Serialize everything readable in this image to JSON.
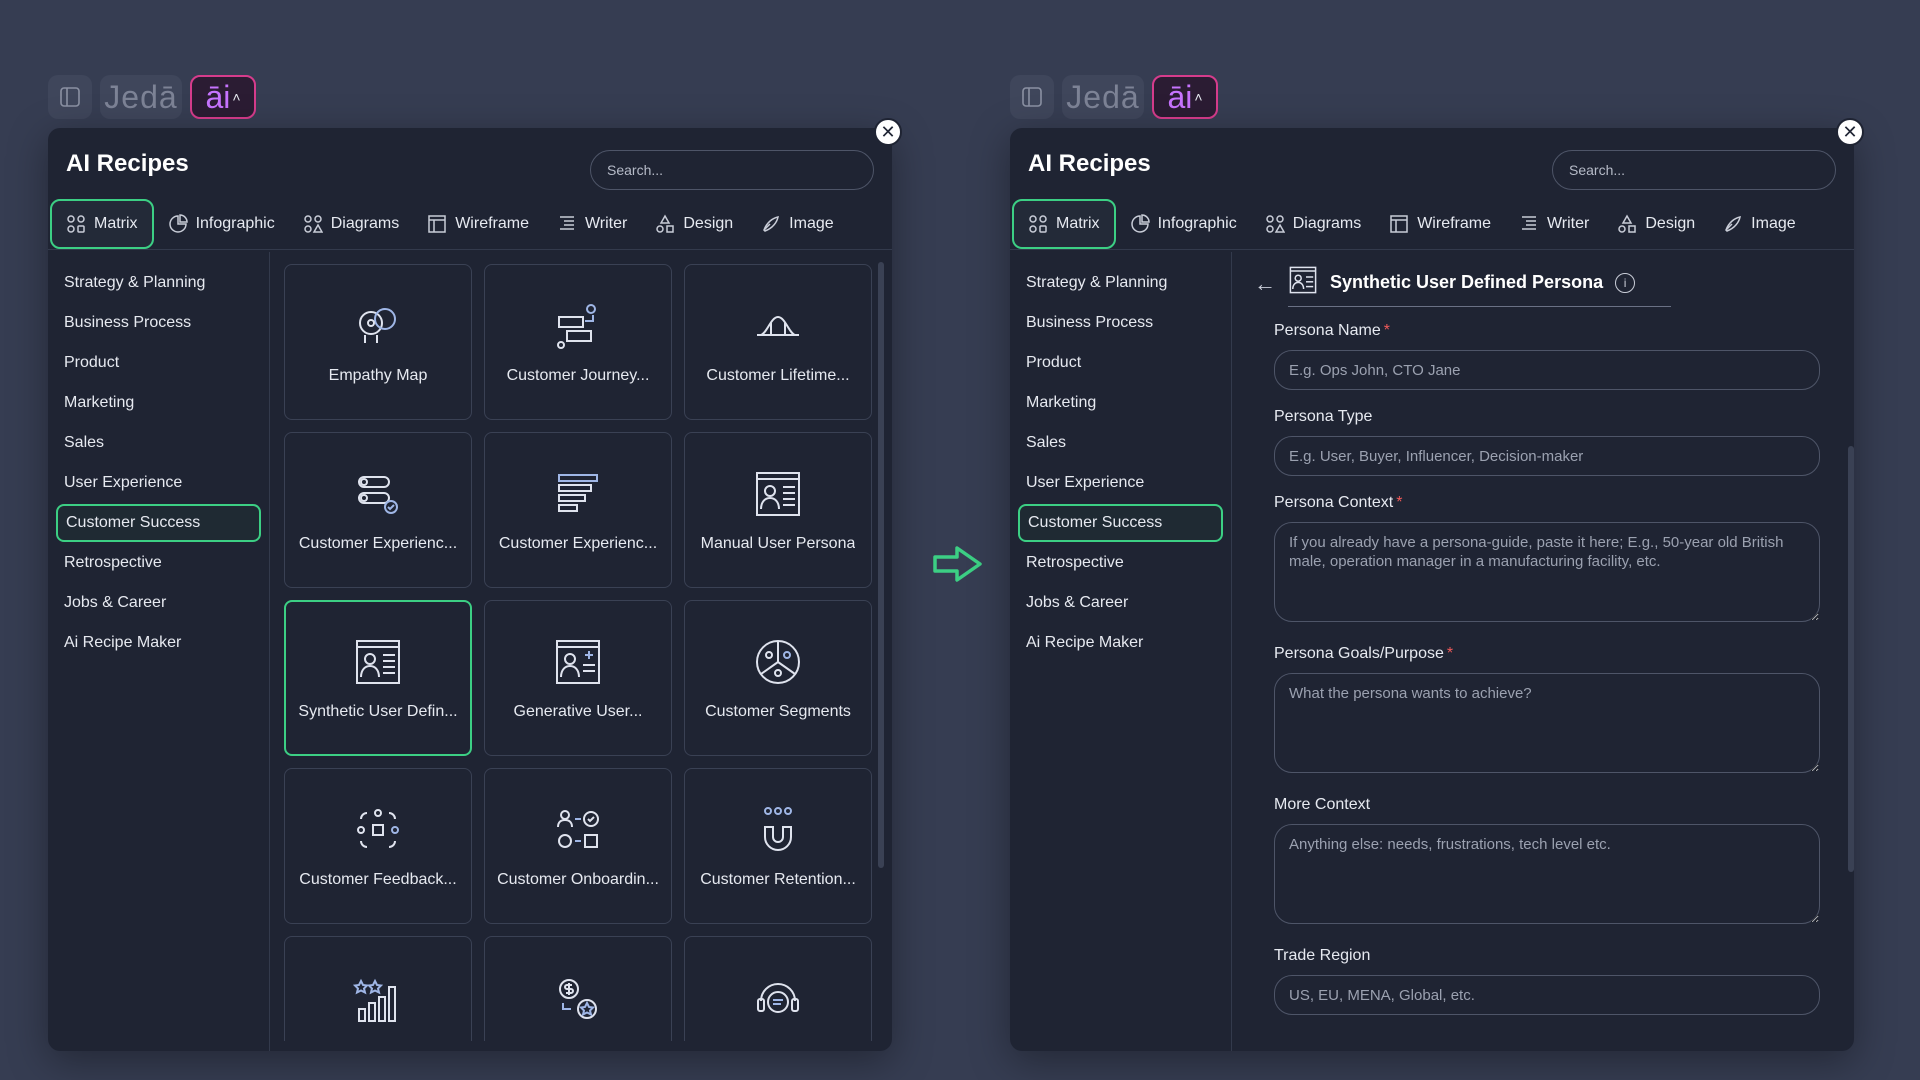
{
  "logo": {
    "text": "Jedā",
    "ai_label": "āi",
    "caret": "^"
  },
  "left_panel": {
    "title": "AI Recipes",
    "search_placeholder": "Search...",
    "tabs": [
      {
        "label": "Matrix",
        "icon": "grid-icon"
      },
      {
        "label": "Infographic",
        "icon": "pie-icon"
      },
      {
        "label": "Diagrams",
        "icon": "diagram-icon"
      },
      {
        "label": "Wireframe",
        "icon": "wireframe-icon"
      },
      {
        "label": "Writer",
        "icon": "writer-icon"
      },
      {
        "label": "Design",
        "icon": "design-icon"
      },
      {
        "label": "Image",
        "icon": "image-icon"
      }
    ],
    "sidebar": [
      "Strategy & Planning",
      "Business Process",
      "Product",
      "Marketing",
      "Sales",
      "User Experience",
      "Customer Success",
      "Retrospective",
      "Jobs & Career",
      "Ai Recipe Maker"
    ],
    "active_sidebar": "Customer Success",
    "cards": [
      {
        "label": "Empathy Map",
        "icon": "empathy-map-icon"
      },
      {
        "label": "Customer Journey...",
        "icon": "customer-journey-icon"
      },
      {
        "label": "Customer Lifetime...",
        "icon": "customer-lifetime-icon"
      },
      {
        "label": "Customer Experienc...",
        "icon": "customer-experience-icon"
      },
      {
        "label": "Customer Experienc...",
        "icon": "customer-experience-list-icon"
      },
      {
        "label": "Manual User Persona",
        "icon": "persona-icon"
      },
      {
        "label": "Synthetic User Defin...",
        "icon": "synthetic-persona-icon"
      },
      {
        "label": "Generative User...",
        "icon": "generative-user-icon"
      },
      {
        "label": "Customer Segments",
        "icon": "segments-icon"
      },
      {
        "label": "Customer Feedback...",
        "icon": "feedback-icon"
      },
      {
        "label": "Customer Onboardin...",
        "icon": "onboarding-icon"
      },
      {
        "label": "Customer Retention...",
        "icon": "retention-icon"
      },
      {
        "label": "",
        "icon": "rating-chart-icon"
      },
      {
        "label": "",
        "icon": "dollar-star-icon"
      },
      {
        "label": "",
        "icon": "support-headset-icon"
      }
    ]
  },
  "right_panel": {
    "title": "AI Recipes",
    "search_placeholder": "Search...",
    "form": {
      "title": "Synthetic User Defined Persona",
      "fields": [
        {
          "label": "Persona Name",
          "required": true,
          "type": "input",
          "placeholder": "E.g. Ops John, CTO Jane"
        },
        {
          "label": "Persona Type",
          "required": false,
          "type": "input",
          "placeholder": "E.g. User, Buyer, Influencer, Decision-maker"
        },
        {
          "label": "Persona Context",
          "required": true,
          "type": "textarea",
          "placeholder": "If you already have a persona-guide, paste it here; E.g., 50-year old British male, operation manager in a manufacturing facility, etc."
        },
        {
          "label": "Persona Goals/Purpose",
          "required": true,
          "type": "textarea",
          "placeholder": "What the persona wants to achieve?"
        },
        {
          "label": "More Context",
          "required": false,
          "type": "textarea",
          "placeholder": "Anything else: needs, frustrations, tech level etc."
        },
        {
          "label": "Trade Region",
          "required": false,
          "type": "input",
          "placeholder": "US, EU, MENA, Global, etc."
        }
      ]
    }
  },
  "colors": {
    "accent": "#3ccf84",
    "ai_border": "#d63c8c",
    "background": "#363d52",
    "panel": "#1f2433"
  }
}
